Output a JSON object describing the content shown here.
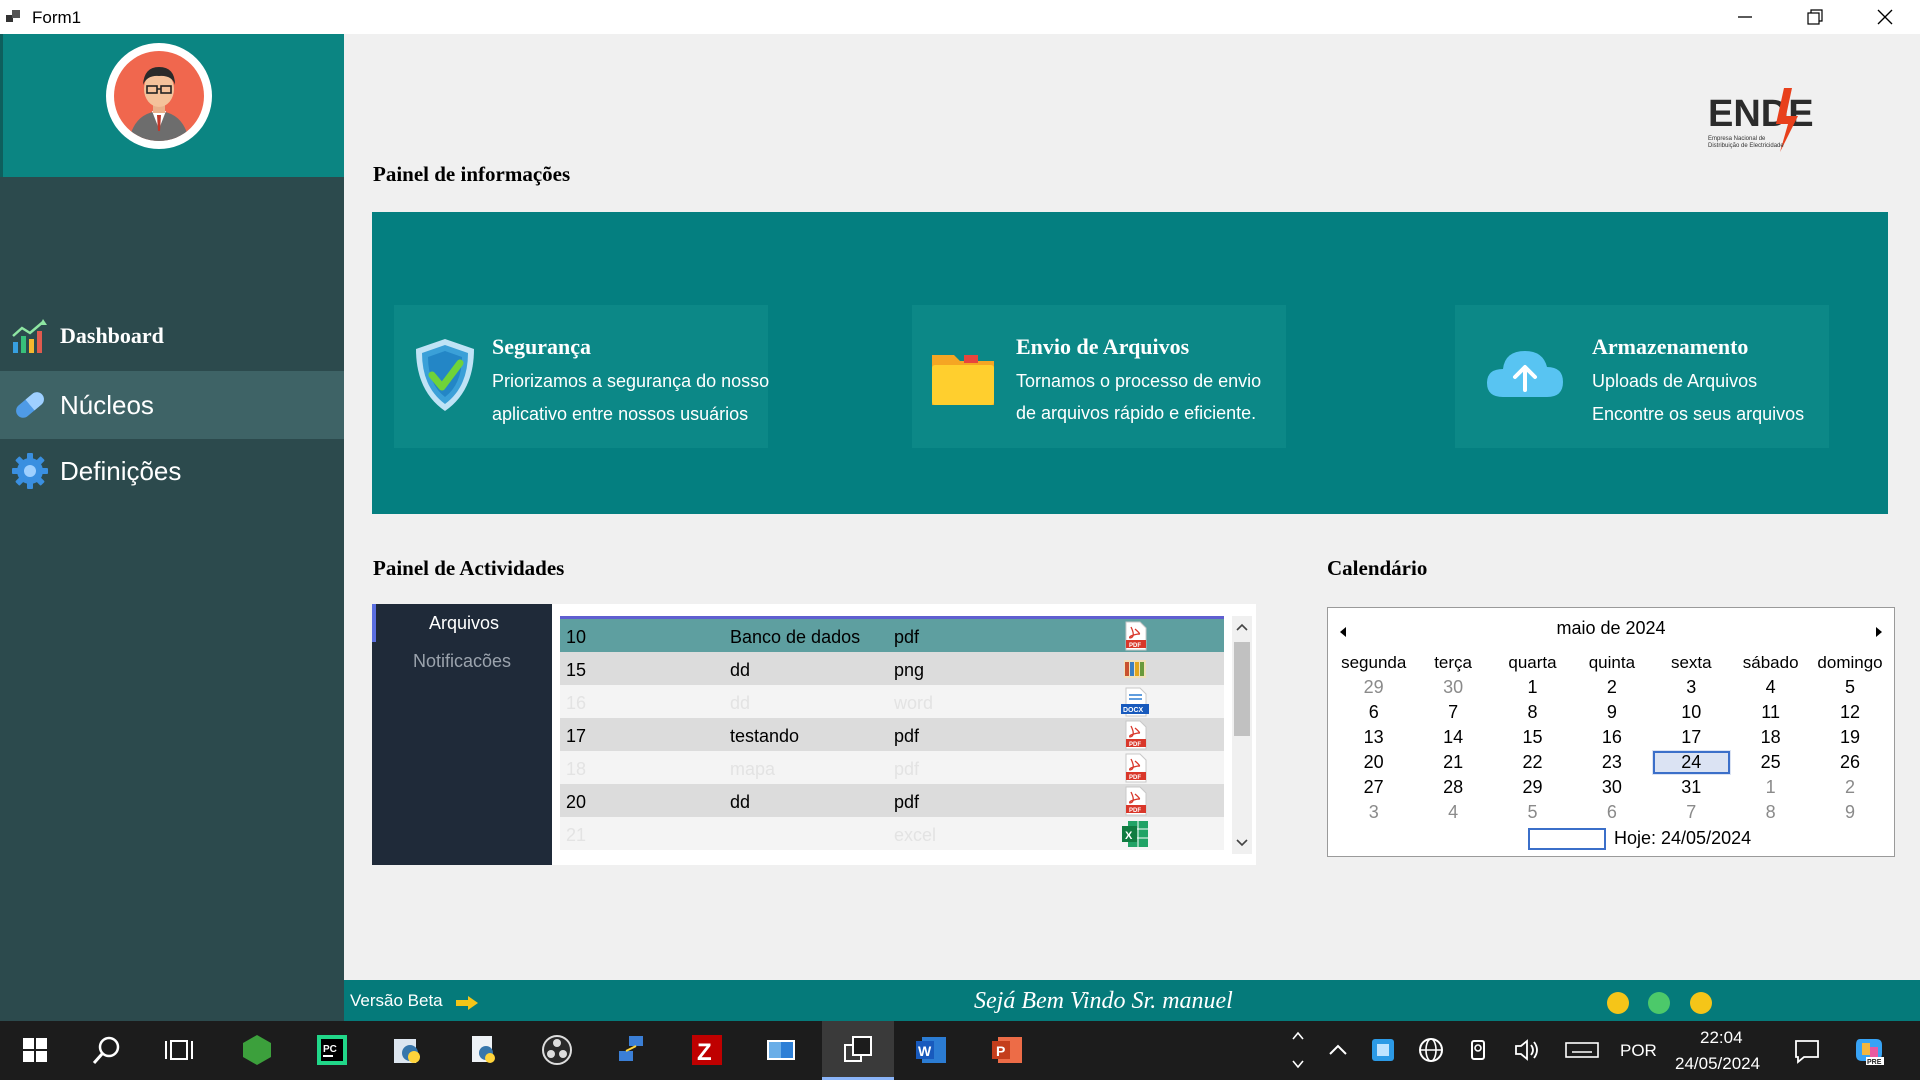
{
  "window": {
    "title": "Form1"
  },
  "sidebar": {
    "items": [
      {
        "label": "Dashboard",
        "icon": "chart-icon"
      },
      {
        "label": "Núcleos",
        "icon": "pill-icon"
      },
      {
        "label": "Definições",
        "icon": "gear-icon"
      }
    ],
    "selected_index": 1
  },
  "logo": {
    "text": "ENDE",
    "subtitle_line1": "Empresa Nacional de",
    "subtitle_line2": "Distribuição de Electricidade"
  },
  "info_panel": {
    "title": "Painel de informações",
    "cards": [
      {
        "title": "Segurança",
        "line1": "Priorizamos a segurança do nosso",
        "line2": "aplicativo entre nossos usuários",
        "icon": "shield-check-icon"
      },
      {
        "title": "Envio de Arquivos",
        "line1": "Tornamos o processo de envio",
        "line2": "de arquivos rápido e eficiente.",
        "icon": "folder-icon"
      },
      {
        "title": "Armazenamento",
        "line1": "Uploads de Arquivos",
        "line2": "Encontre os seus arquivos",
        "icon": "cloud-upload-icon"
      }
    ]
  },
  "activities": {
    "title": "Painel de Actividades",
    "tabs": [
      "Arquivos",
      "Notificacões"
    ],
    "rows": [
      {
        "id": "10",
        "name": "Banco de dados",
        "type": "pdf",
        "icon": "pdf-icon"
      },
      {
        "id": "15",
        "name": "dd",
        "type": "png",
        "icon": "png-icon"
      },
      {
        "id": "16",
        "name": "dd",
        "type": "word",
        "icon": "docx-icon"
      },
      {
        "id": "17",
        "name": "testando",
        "type": "pdf",
        "icon": "pdf-icon"
      },
      {
        "id": "18",
        "name": "mapa",
        "type": "pdf",
        "icon": "pdf-icon"
      },
      {
        "id": "20",
        "name": "dd",
        "type": "pdf",
        "icon": "pdf-icon"
      },
      {
        "id": "21",
        "name": "",
        "type": "excel",
        "icon": "excel-icon"
      }
    ]
  },
  "calendar": {
    "title": "Calendário",
    "month": "maio de 2024",
    "weekdays": [
      "segunda",
      "terça",
      "quarta",
      "quinta",
      "sexta",
      "sábado",
      "domingo"
    ],
    "weeks": [
      [
        "29",
        "30",
        "1",
        "2",
        "3",
        "4",
        "5"
      ],
      [
        "6",
        "7",
        "8",
        "9",
        "10",
        "11",
        "12"
      ],
      [
        "13",
        "14",
        "15",
        "16",
        "17",
        "18",
        "19"
      ],
      [
        "20",
        "21",
        "22",
        "23",
        "24",
        "25",
        "26"
      ],
      [
        "27",
        "28",
        "29",
        "30",
        "31",
        "1",
        "2"
      ],
      [
        "3",
        "4",
        "5",
        "6",
        "7",
        "8",
        "9"
      ]
    ],
    "selected_day": "24",
    "today_label": "Hoje: 24/05/2024"
  },
  "status": {
    "version": "Versão Beta",
    "welcome": "Sejá Bem Vindo Sr.   manuel",
    "dot_colors": [
      "#f5c518",
      "#4cc96a",
      "#f5c518"
    ]
  },
  "taskbar": {
    "language": "POR",
    "time": "22:04",
    "date": "24/05/2024"
  }
}
